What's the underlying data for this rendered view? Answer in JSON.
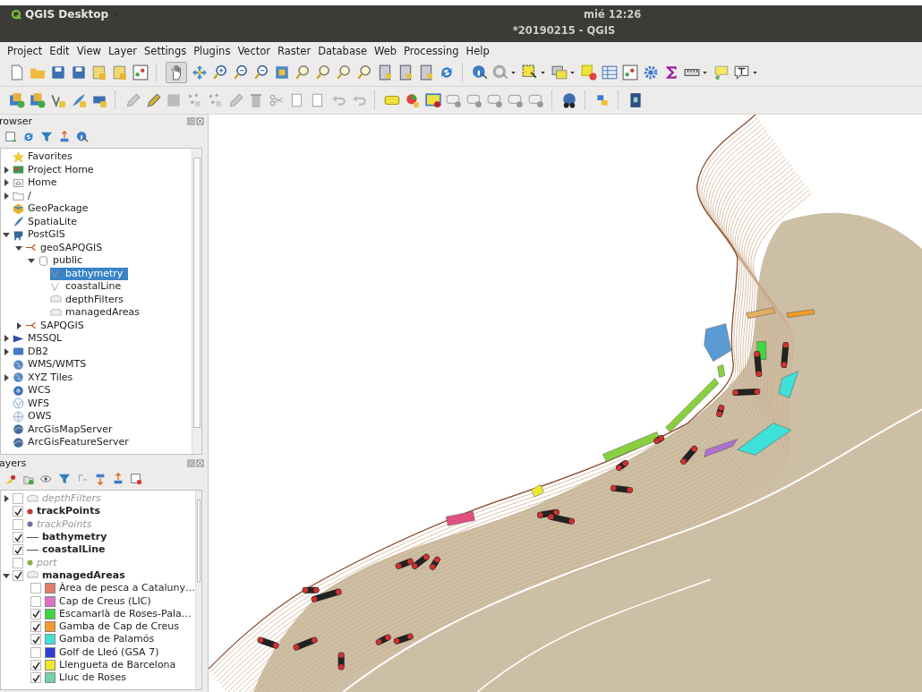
{
  "top_bar": {
    "app_menu": "QGIS Desktop",
    "clock": "mié 12:26"
  },
  "window": {
    "title": "*20190215 - QGIS"
  },
  "menu": [
    "Project",
    "Edit",
    "View",
    "Layer",
    "Settings",
    "Plugins",
    "Vector",
    "Raster",
    "Database",
    "Web",
    "Processing",
    "Help"
  ],
  "toolbar": {
    "pan_selected": true
  },
  "browser": {
    "title": "rowser",
    "items": [
      {
        "label": "Favorites",
        "selected": false
      },
      {
        "label": "Project Home",
        "selected": false,
        "expanded": false
      },
      {
        "label": "Home",
        "selected": false,
        "expanded": false
      },
      {
        "label": "/",
        "selected": false,
        "expanded": false
      },
      {
        "label": "GeoPackage",
        "selected": false
      },
      {
        "label": "SpatiaLite",
        "selected": false
      },
      {
        "label": "PostGIS",
        "selected": false,
        "expanded": true,
        "children": [
          {
            "label": "geoSAPQGIS",
            "selected": false,
            "expanded": true,
            "children": [
              {
                "label": "public",
                "selected": false,
                "expanded": true,
                "children": [
                  {
                    "label": "bathymetry",
                    "selected": true
                  },
                  {
                    "label": "coastalLine",
                    "selected": false
                  },
                  {
                    "label": "depthFilters",
                    "selected": false
                  },
                  {
                    "label": "managedAreas",
                    "selected": false
                  }
                ]
              }
            ]
          },
          {
            "label": "SAPQGIS",
            "selected": false,
            "expanded": false
          }
        ]
      },
      {
        "label": "MSSQL",
        "selected": false,
        "expanded": false
      },
      {
        "label": "DB2",
        "selected": false,
        "expanded": false
      },
      {
        "label": "WMS/WMTS",
        "selected": false
      },
      {
        "label": "XYZ Tiles",
        "selected": false,
        "expanded": false
      },
      {
        "label": "WCS",
        "selected": false
      },
      {
        "label": "WFS",
        "selected": false
      },
      {
        "label": "OWS",
        "selected": false
      },
      {
        "label": "ArcGisMapServer",
        "selected": false
      },
      {
        "label": "ArcGisFeatureServer",
        "selected": false
      }
    ]
  },
  "layers": {
    "title": "ayers",
    "items": [
      {
        "label": "depthFilters",
        "kind": "group",
        "checked": false,
        "expanded": false
      },
      {
        "label": "trackPoints",
        "kind": "point",
        "checked": true,
        "color": "#c0392b"
      },
      {
        "label": "trackPoints",
        "kind": "point",
        "checked": false,
        "color": "#7a6f9b"
      },
      {
        "label": "bathymetry",
        "kind": "line",
        "checked": true
      },
      {
        "label": "coastalLine",
        "kind": "line",
        "checked": true
      },
      {
        "label": "port",
        "kind": "point",
        "checked": false,
        "color": "#8bb04a"
      },
      {
        "label": "managedAreas",
        "kind": "group",
        "checked": true,
        "expanded": true,
        "children": [
          {
            "label": "Àrea de pesca a Cataluny…",
            "kind": "category",
            "checked": false,
            "color": "#e27c6c"
          },
          {
            "label": "Cap de Creus (LIC)",
            "kind": "category",
            "checked": false,
            "color": "#e070c8"
          },
          {
            "label": "Escamarlà de Roses-Pala…",
            "kind": "category",
            "checked": true,
            "color": "#3ed63e"
          },
          {
            "label": "Gamba de Cap de Creus",
            "kind": "category",
            "checked": true,
            "color": "#f39a2a"
          },
          {
            "label": "Gamba de Palamós",
            "kind": "category",
            "checked": true,
            "color": "#3ee0d8"
          },
          {
            "label": "Golf de Lleó (GSA 7)",
            "kind": "category",
            "checked": false,
            "color": "#2c3fd0"
          },
          {
            "label": "Llengueta de Barcelona",
            "kind": "category",
            "checked": true,
            "color": "#eaea2a"
          },
          {
            "label": "Lluc de Roses",
            "kind": "category",
            "checked": true,
            "color": "#6fd6a8"
          }
        ]
      }
    ]
  }
}
